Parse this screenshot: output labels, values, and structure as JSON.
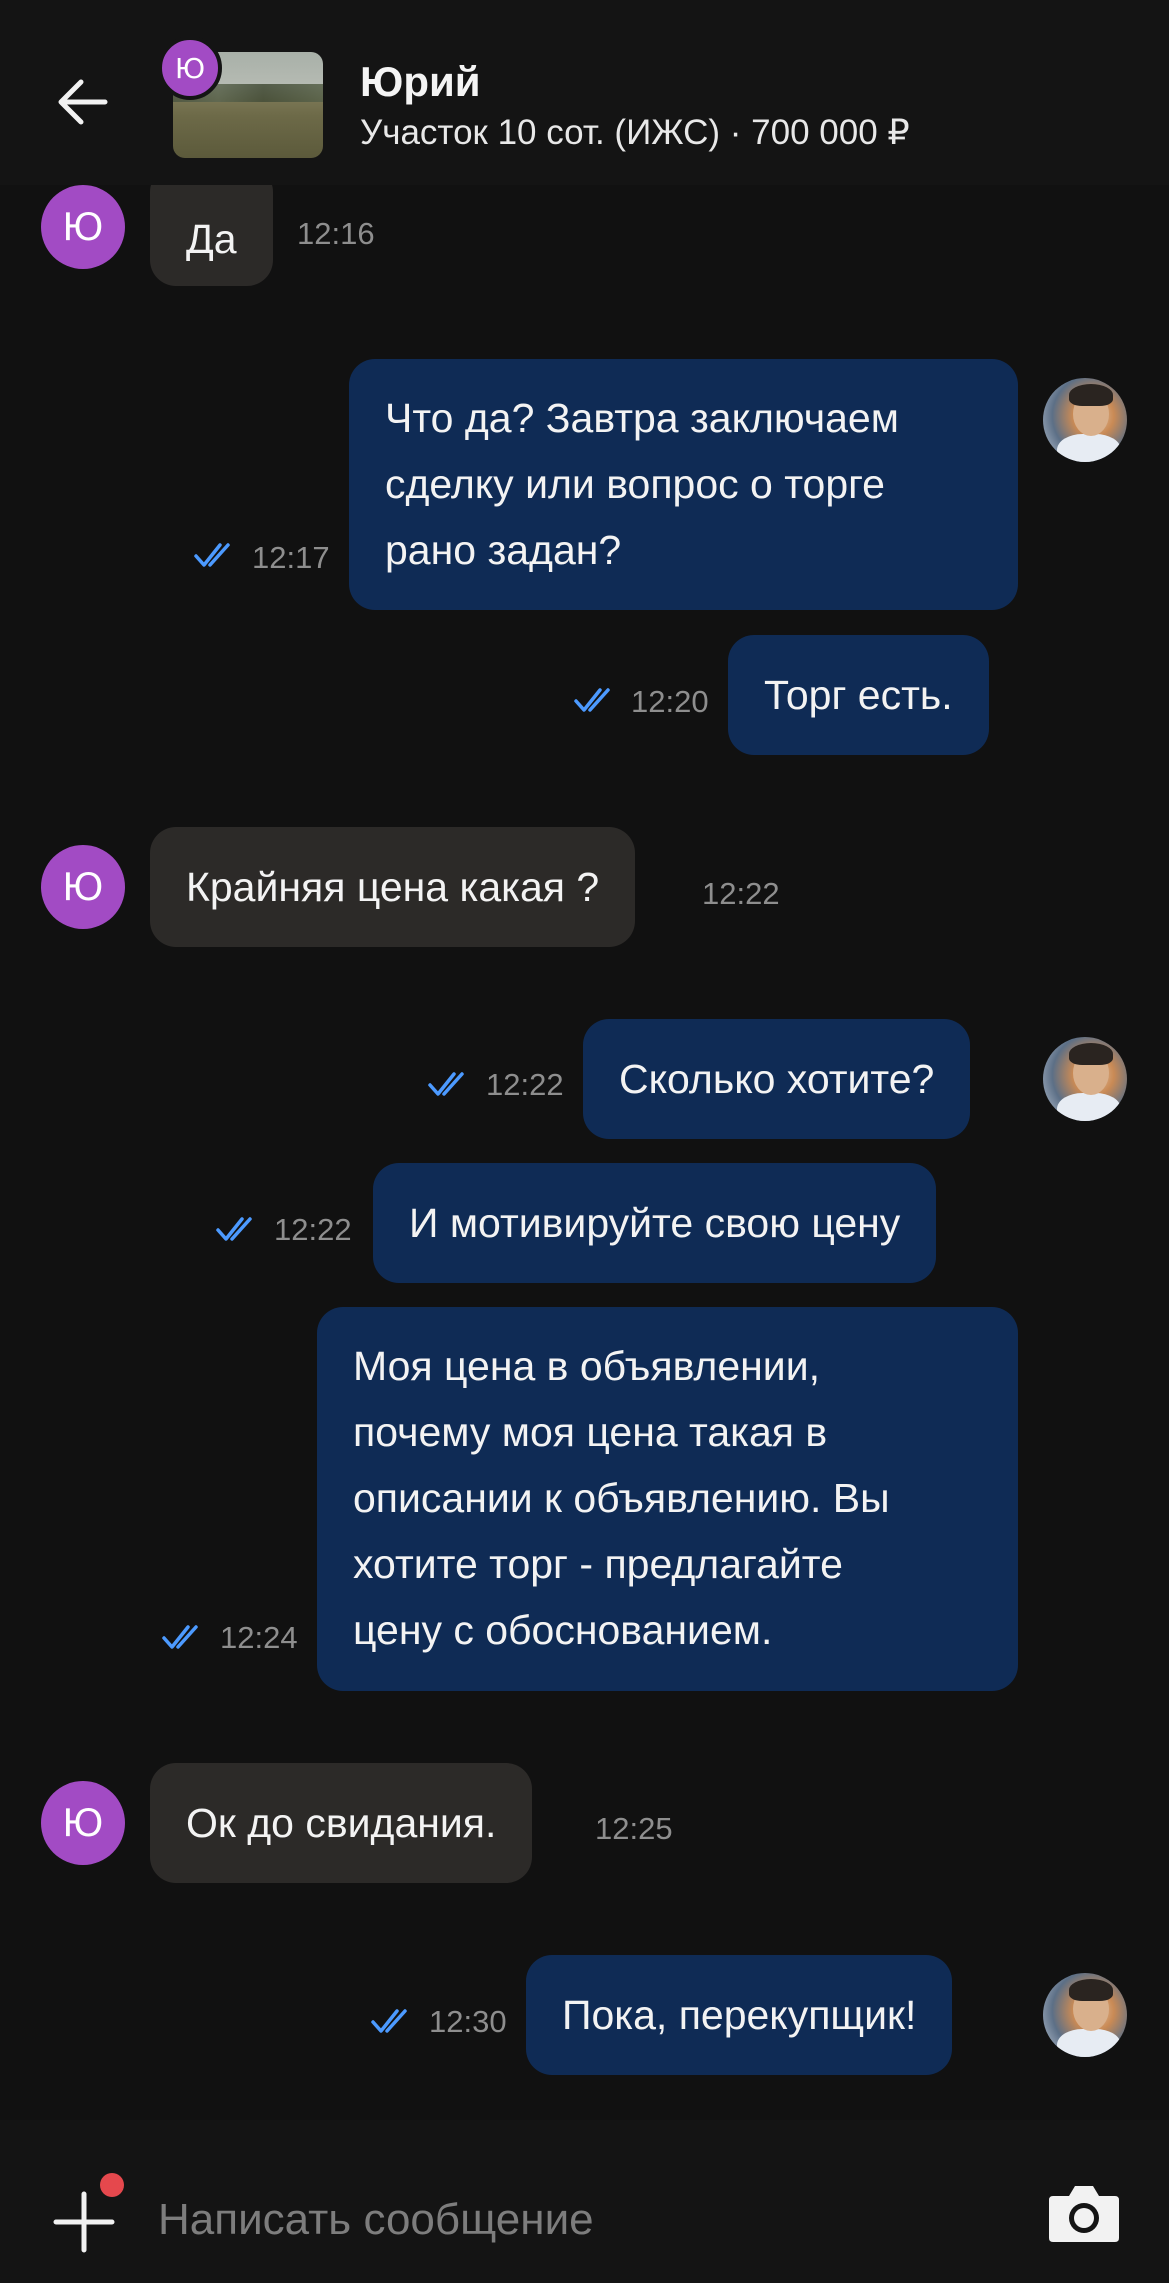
{
  "header": {
    "contact_name": "Юрий",
    "ad_title": "Участок 10 сот. (ИЖС) · 700 000 ₽",
    "seller_initial": "Ю"
  },
  "messages": [
    {
      "dir": "in",
      "text": "Да",
      "time": "12:16"
    },
    {
      "dir": "out",
      "text": "Что да? Завтра заключаем\nсделку или вопрос о торге\nрано задан?",
      "time": "12:17",
      "read": true
    },
    {
      "dir": "out",
      "text": "Торг есть.",
      "time": "12:20",
      "read": true
    },
    {
      "dir": "in",
      "text": "Крайняя цена какая ?",
      "time": "12:22"
    },
    {
      "dir": "out",
      "text": "Сколько хотите?",
      "time": "12:22",
      "read": true
    },
    {
      "dir": "out",
      "text": "И мотивируйте свою цену",
      "time": "12:22",
      "read": true
    },
    {
      "dir": "out",
      "text": "Моя цена в объявлении,\nпочему моя цена такая в\nописании к объявлению. Вы\nхотите торг - предлагайте\nцену с обоснованием.",
      "time": "12:24",
      "read": true
    },
    {
      "dir": "in",
      "text": "Ок до свидания.",
      "time": "12:25"
    },
    {
      "dir": "out",
      "text": "Пока, перекупщик!",
      "time": "12:30",
      "read": true
    }
  ],
  "composer": {
    "placeholder": "Написать сообщение"
  },
  "colors": {
    "background": "#111111",
    "incoming_bubble": "#2c2a28",
    "outgoing_bubble": "#0f2b55",
    "avatar": "#a24bc4",
    "read_ticks": "#4c9aff",
    "notification_dot": "#e5484d"
  },
  "icons": {
    "back": "arrow-left-icon",
    "attach": "plus-icon",
    "camera": "camera-icon",
    "read": "double-check-icon"
  }
}
